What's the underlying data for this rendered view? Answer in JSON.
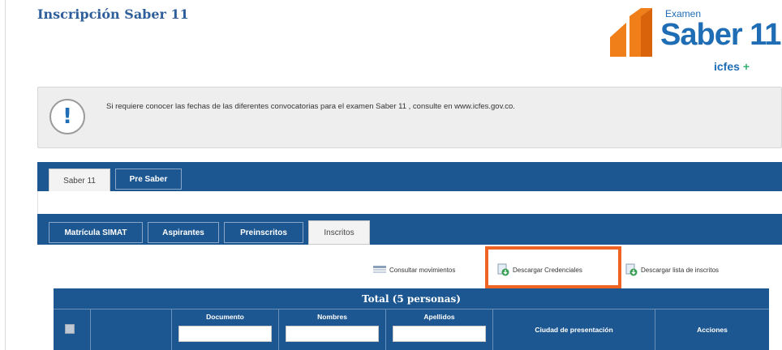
{
  "header": {
    "title": "Inscripción Saber 11"
  },
  "logo": {
    "examen": "Examen",
    "saber": "Saber 11°",
    "icfes": "icfes",
    "icfes_mark": "+"
  },
  "info": {
    "icon": "!",
    "message": "Si requiere conocer las fechas de las diferentes convocatorias para el examen Saber 11 , consulte en www.icfes.gov.co."
  },
  "exam_tabs": [
    {
      "label": "Saber 11",
      "active": true
    },
    {
      "label": "Pre Saber",
      "active": false
    }
  ],
  "sub_tabs": [
    {
      "label": "Matrícula SIMAT",
      "active": false
    },
    {
      "label": "Aspirantes",
      "active": false
    },
    {
      "label": "Preinscritos",
      "active": false
    },
    {
      "label": "Inscritos",
      "active": true
    }
  ],
  "actions": [
    {
      "label": "Consultar movimientos",
      "icon": "list-icon"
    },
    {
      "label": "Descargar Credenciales",
      "icon": "download-icon"
    },
    {
      "label": "Descargar lista de inscritos",
      "icon": "download-icon"
    }
  ],
  "table": {
    "total": "Total (5 personas)",
    "columns": [
      "Documento",
      "Nombres",
      "Apellidos",
      "Ciudad de presentación",
      "Acciones"
    ]
  },
  "colors": {
    "primary": "#1d5792",
    "title": "#2f5f9b",
    "highlight": "#f06423",
    "logo_orange": "#f07f1a"
  }
}
